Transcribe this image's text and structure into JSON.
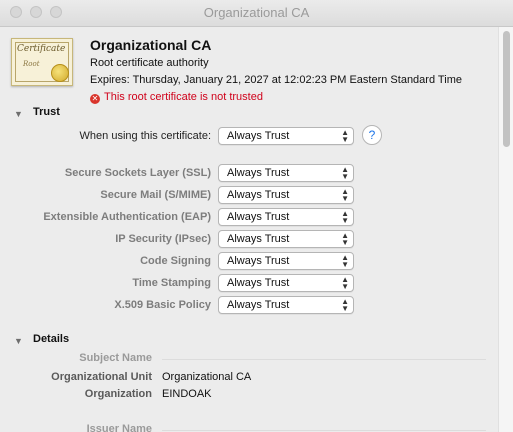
{
  "window": {
    "title": "Organizational CA"
  },
  "certificate": {
    "icon_text_1": "Certificate",
    "icon_text_2": "Root",
    "name": "Organizational CA",
    "kind": "Root certificate authority",
    "expires": "Expires: Thursday, January 21, 2027 at 12:02:23 PM Eastern Standard Time",
    "warning": "This root certificate is not trusted"
  },
  "trust": {
    "section_label": "Trust",
    "when_using_label": "When using this certificate:",
    "when_using_value": "Always Trust",
    "help_label": "?",
    "rows": [
      {
        "label": "Secure Sockets Layer (SSL)",
        "value": "Always Trust"
      },
      {
        "label": "Secure Mail (S/MIME)",
        "value": "Always Trust"
      },
      {
        "label": "Extensible Authentication (EAP)",
        "value": "Always Trust"
      },
      {
        "label": "IP Security (IPsec)",
        "value": "Always Trust"
      },
      {
        "label": "Code Signing",
        "value": "Always Trust"
      },
      {
        "label": "Time Stamping",
        "value": "Always Trust"
      },
      {
        "label": "X.509 Basic Policy",
        "value": "Always Trust"
      }
    ]
  },
  "details": {
    "section_label": "Details",
    "subject_header": "Subject Name",
    "org_unit_label": "Organizational Unit",
    "org_unit_value": "Organizational CA",
    "organization_label": "Organization",
    "organization_value": "EINDOAK",
    "issuer_header": "Issuer Name"
  },
  "icons": {
    "disclosure": "disclosure-triangle-down",
    "warning": "x-circle-warning",
    "chevron": "popup-up-down-chevrons"
  },
  "colors": {
    "warning": "#d0021b",
    "help": "#1a73e8"
  }
}
